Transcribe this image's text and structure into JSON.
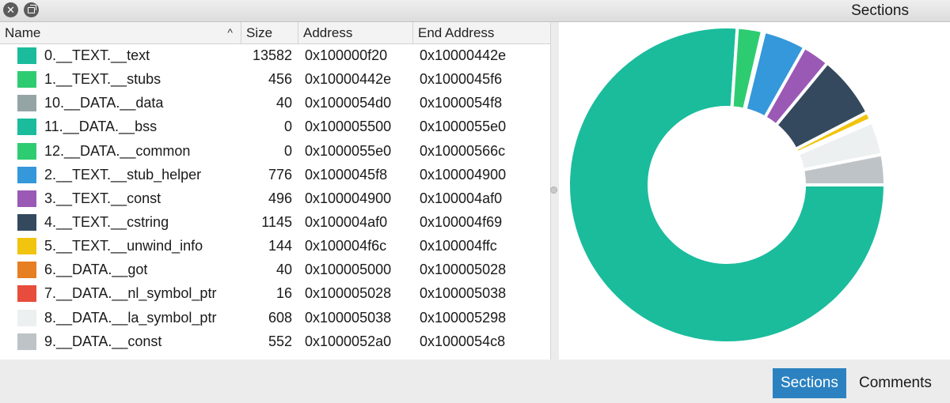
{
  "window": {
    "title": "Sections"
  },
  "icons": {
    "close": "close-icon",
    "float": "float-window-icon",
    "sort": "sort-ascending-icon"
  },
  "table": {
    "columns": {
      "name": "Name",
      "size": "Size",
      "address": "Address",
      "end_address": "End Address"
    },
    "sort_glyph": "^",
    "rows": [
      {
        "name": "0.__TEXT.__text",
        "size": "13582",
        "address": "0x100000f20",
        "end": "0x10000442e",
        "color": "#1abc9c"
      },
      {
        "name": "1.__TEXT.__stubs",
        "size": "456",
        "address": "0x10000442e",
        "end": "0x1000045f6",
        "color": "#2ecc71"
      },
      {
        "name": "10.__DATA.__data",
        "size": "40",
        "address": "0x1000054d0",
        "end": "0x1000054f8",
        "color": "#95a5a6"
      },
      {
        "name": "11.__DATA.__bss",
        "size": "0",
        "address": "0x100005500",
        "end": "0x1000055e0",
        "color": "#1abc9c"
      },
      {
        "name": "12.__DATA.__common",
        "size": "0",
        "address": "0x1000055e0",
        "end": "0x10000566c",
        "color": "#2ecc71"
      },
      {
        "name": "2.__TEXT.__stub_helper",
        "size": "776",
        "address": "0x1000045f8",
        "end": "0x100004900",
        "color": "#3498db"
      },
      {
        "name": "3.__TEXT.__const",
        "size": "496",
        "address": "0x100004900",
        "end": "0x100004af0",
        "color": "#9b59b6"
      },
      {
        "name": "4.__TEXT.__cstring",
        "size": "1145",
        "address": "0x100004af0",
        "end": "0x100004f69",
        "color": "#34495e"
      },
      {
        "name": "5.__TEXT.__unwind_info",
        "size": "144",
        "address": "0x100004f6c",
        "end": "0x100004ffc",
        "color": "#f1c40f"
      },
      {
        "name": "6.__DATA.__got",
        "size": "40",
        "address": "0x100005000",
        "end": "0x100005028",
        "color": "#e67e22"
      },
      {
        "name": "7.__DATA.__nl_symbol_ptr",
        "size": "16",
        "address": "0x100005028",
        "end": "0x100005038",
        "color": "#e74c3c"
      },
      {
        "name": "8.__DATA.__la_symbol_ptr",
        "size": "608",
        "address": "0x100005038",
        "end": "0x100005298",
        "color": "#ecf0f1"
      },
      {
        "name": "9.__DATA.__const",
        "size": "552",
        "address": "0x1000052a0",
        "end": "0x1000054c8",
        "color": "#bdc3c7"
      }
    ]
  },
  "tabs": {
    "sections": "Sections",
    "comments": "Comments",
    "active": "sections"
  }
}
